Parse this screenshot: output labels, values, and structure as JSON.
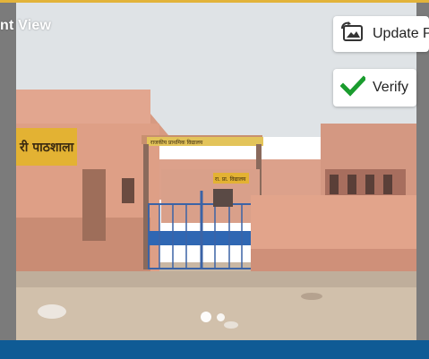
{
  "header": {
    "title": "nt View"
  },
  "actions": {
    "update_label": "Update P",
    "update_icon": "photo-refresh-icon",
    "verify_label": "Verify",
    "verify_icon": "checkmark-icon"
  },
  "photo": {
    "sign_left": "री पाठशाला",
    "sign_gate": "रा. प्रा. विद्यालय",
    "sign_arch": "राजकीय प्राथमिक विद्यालय"
  },
  "carousel": {
    "pages": 2,
    "active": 1
  },
  "colors": {
    "accent_bar": "#0f5b95",
    "top_line": "#e2b33a",
    "check": "#1a9c2e"
  }
}
